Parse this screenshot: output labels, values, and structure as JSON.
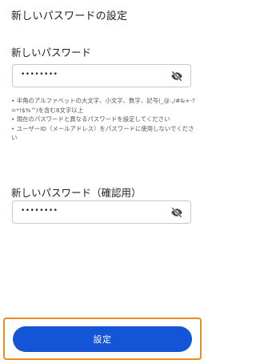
{
  "page": {
    "title": "新しいパスワードの設定"
  },
  "new_password": {
    "label": "新しいパスワード",
    "value": "••••••••"
  },
  "hints": [
    "• 半角のアルファベットの大文字、小文字、数字、記号(_@.,/#&+-?=*!$%^)を含む8文字以上",
    "• 現在のパスワードと異なるパスワードを設定してください",
    "• ユーザーID（メールアドレス）をパスワードに使用しないでください"
  ],
  "confirm_password": {
    "label": "新しいパスワード（確認用）",
    "value": "••••••••"
  },
  "submit": {
    "label": "設定"
  },
  "colors": {
    "primary": "#1455d8",
    "highlight": "#f08a24"
  },
  "icons": {
    "visibility_toggle": "eye-off-icon"
  }
}
